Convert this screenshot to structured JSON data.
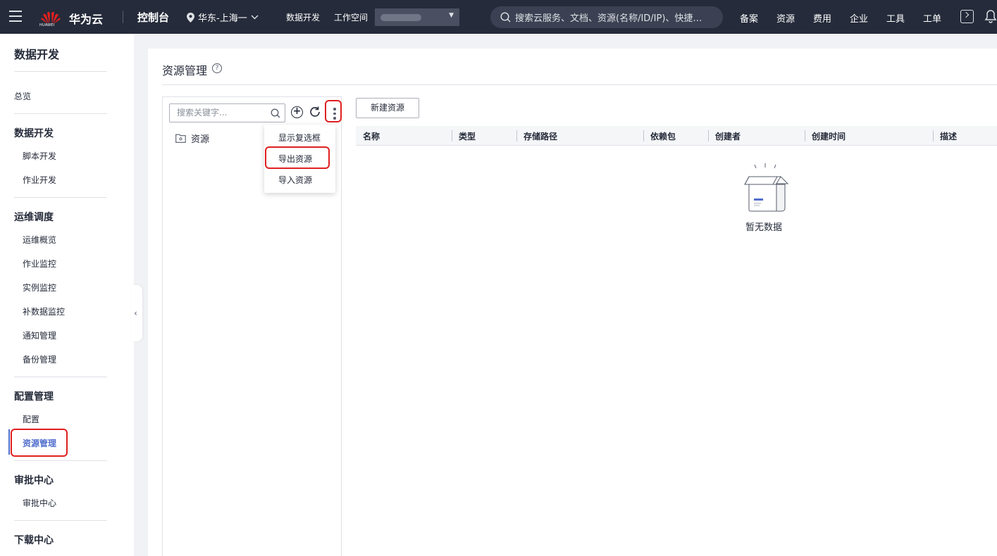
{
  "topbar": {
    "logo_text": "HUAWEI",
    "brand": "华为云",
    "console": "控制台",
    "region": "华东-上海一",
    "nav_dev": "数据开发",
    "nav_workspace": "工作空间",
    "search_placeholder": "搜索云服务、文档、资源(名称/ID/IP)、快捷…",
    "right_nav": [
      "备案",
      "资源",
      "费用",
      "企业",
      "工具",
      "工单"
    ]
  },
  "sidebar": {
    "title": "数据开发",
    "overview": "总览",
    "groups": {
      "dev": {
        "label": "数据开发",
        "items": [
          "脚本开发",
          "作业开发"
        ]
      },
      "ops": {
        "label": "运维调度",
        "items": [
          "运维概览",
          "作业监控",
          "实例监控",
          "补数据监控",
          "通知管理",
          "备份管理"
        ]
      },
      "config": {
        "label": "配置管理",
        "items": [
          "配置",
          "资源管理"
        ]
      },
      "approval": {
        "label": "审批中心",
        "items": [
          "审批中心"
        ]
      },
      "download": {
        "label": "下载中心"
      }
    },
    "active_item": "资源管理"
  },
  "main": {
    "title": "资源管理",
    "keyword_placeholder": "搜索关键字...",
    "tree_root": "资源",
    "menu": [
      "显示复选框",
      "导出资源",
      "导入资源"
    ],
    "new_button": "新建资源",
    "columns": [
      "名称",
      "类型",
      "存储路径",
      "依赖包",
      "创建者",
      "创建时间",
      "描述"
    ],
    "empty_text": "暂无数据"
  },
  "colors": {
    "topbar": "#252b3a",
    "accent": "#526ecc",
    "highlight": "#e02020"
  }
}
